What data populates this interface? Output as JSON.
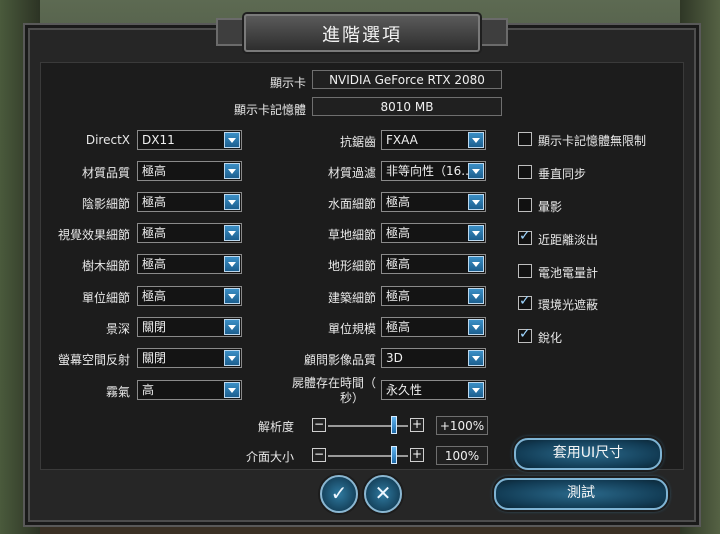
{
  "title": "進階選項",
  "gpu": {
    "label": "顯示卡",
    "value": "NVIDIA GeForce RTX 2080"
  },
  "vram": {
    "label": "顯示卡記憶體",
    "value": "8010 MB"
  },
  "col1": [
    {
      "label": "DirectX",
      "value": "DX11"
    },
    {
      "label": "材質品質",
      "value": "極高"
    },
    {
      "label": "陰影細節",
      "value": "極高"
    },
    {
      "label": "視覺效果細節",
      "value": "極高"
    },
    {
      "label": "樹木細節",
      "value": "極高"
    },
    {
      "label": "單位細節",
      "value": "極高"
    },
    {
      "label": "景深",
      "value": "關閉"
    },
    {
      "label": "螢幕空間反射",
      "value": "關閉"
    },
    {
      "label": "霧氣",
      "value": "高"
    }
  ],
  "col2": [
    {
      "label": "抗鋸齒",
      "value": "FXAA"
    },
    {
      "label": "材質過濾",
      "value": "非等向性（16..."
    },
    {
      "label": "水面細節",
      "value": "極高"
    },
    {
      "label": "草地細節",
      "value": "極高"
    },
    {
      "label": "地形細節",
      "value": "極高"
    },
    {
      "label": "建築細節",
      "value": "極高"
    },
    {
      "label": "單位規模",
      "value": "極高"
    },
    {
      "label": "顧問影像品質",
      "value": "3D"
    },
    {
      "label": "屍體存在時間（",
      "label2": "秒）",
      "value": "永久性"
    }
  ],
  "checks": [
    {
      "label": "顯示卡記憶體無限制",
      "checked": false
    },
    {
      "label": "垂直同步",
      "checked": false
    },
    {
      "label": "暈影",
      "checked": false
    },
    {
      "label": "近距離淡出",
      "checked": true
    },
    {
      "label": "電池電量計",
      "checked": false
    },
    {
      "label": "環境光遮蔽",
      "checked": true
    },
    {
      "label": "銳化",
      "checked": true
    }
  ],
  "resolution": {
    "label": "解析度",
    "value": "+100%",
    "level": 0.82
  },
  "ui_size": {
    "label": "介面大小",
    "value": "100%",
    "level": 0.82
  },
  "slider_minus": "−",
  "slider_plus": "+",
  "apply_ui": "套用UI尺寸",
  "test": "測試",
  "confirm_icon": "✓",
  "cancel_icon": "✕"
}
